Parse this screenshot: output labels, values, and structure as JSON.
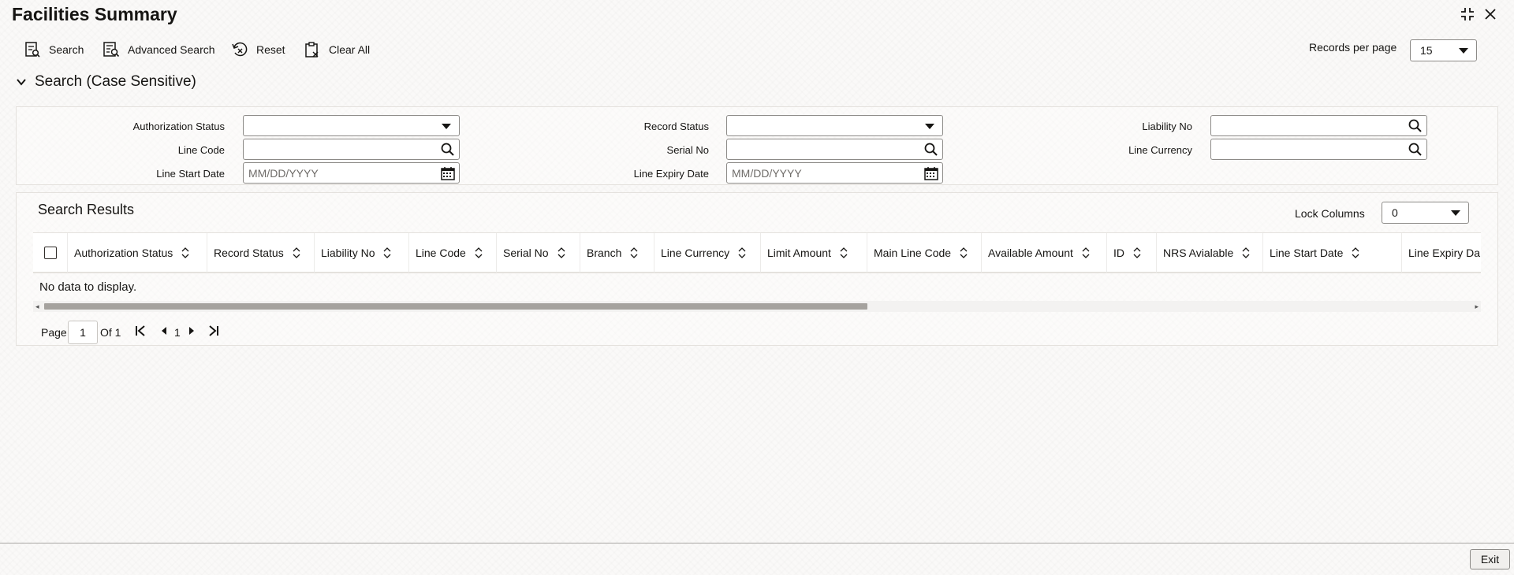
{
  "header": {
    "title": "Facilities Summary"
  },
  "toolbar": {
    "search_label": "Search",
    "advanced_search_label": "Advanced Search",
    "reset_label": "Reset",
    "clear_all_label": "Clear All",
    "records_per_page_label": "Records per page",
    "records_per_page_value": "15"
  },
  "search_section": {
    "title": "Search (Case Sensitive)",
    "fields": {
      "authorization_status": {
        "label": "Authorization Status",
        "value": ""
      },
      "record_status": {
        "label": "Record Status",
        "value": ""
      },
      "liability_no": {
        "label": "Liability No",
        "value": ""
      },
      "line_code": {
        "label": "Line Code",
        "value": ""
      },
      "serial_no": {
        "label": "Serial No",
        "value": ""
      },
      "line_currency": {
        "label": "Line Currency",
        "value": ""
      },
      "line_start_date": {
        "label": "Line Start Date",
        "placeholder": "MM/DD/YYYY"
      },
      "line_expiry_date": {
        "label": "Line Expiry Date",
        "placeholder": "MM/DD/YYYY"
      }
    }
  },
  "results": {
    "title": "Search Results",
    "lock_columns_label": "Lock Columns",
    "lock_columns_value": "0",
    "columns": [
      "Authorization Status",
      "Record Status",
      "Liability No",
      "Line Code",
      "Serial No",
      "Branch",
      "Line Currency",
      "Limit Amount",
      "Main Line Code",
      "Available Amount",
      "ID",
      "NRS Avialable",
      "Line Start Date",
      "Line Expiry Da"
    ],
    "empty_message": "No data to display."
  },
  "pagination": {
    "page_label": "Page",
    "current_page": "1",
    "of_label": "Of 1",
    "page_link": "1"
  },
  "footer": {
    "exit_label": "Exit"
  },
  "icons": {
    "restore": "restore-icon",
    "close": "close-icon",
    "search_doc": "search-document-icon",
    "advanced_search": "advanced-search-icon",
    "reset": "reset-icon",
    "clear_all": "clipboard-clear-icon",
    "chevron": "chevron-down-icon",
    "magnifier": "magnifier-icon",
    "calendar": "calendar-icon",
    "sort": "sort-icon"
  }
}
